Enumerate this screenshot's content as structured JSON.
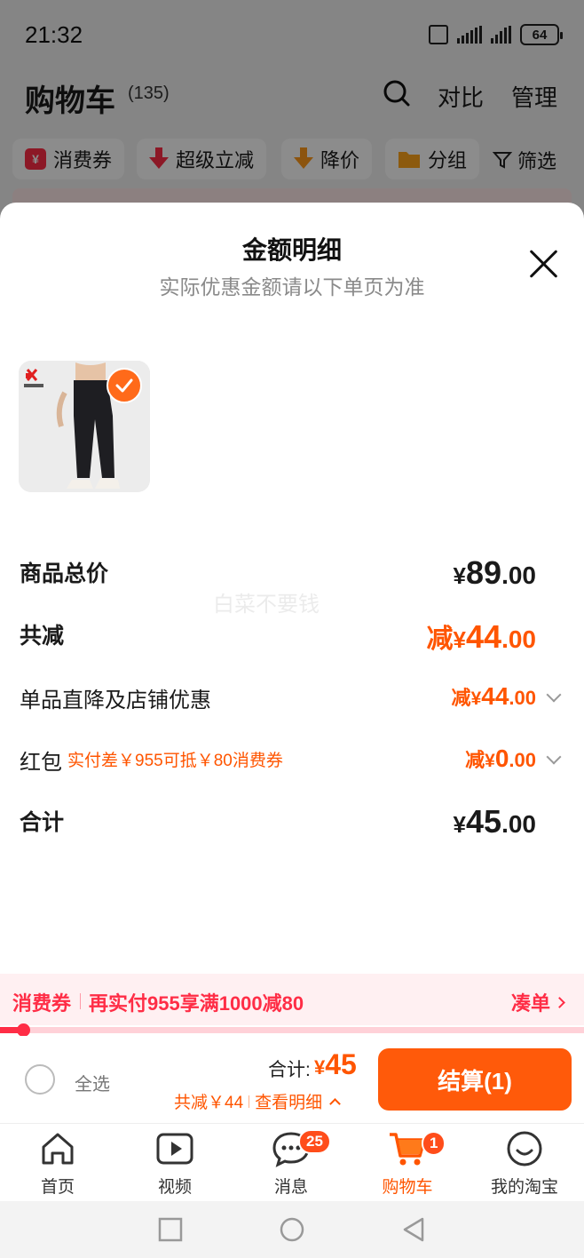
{
  "status_bar": {
    "time": "21:32",
    "battery": "64"
  },
  "background_page": {
    "title": "购物车",
    "count": "(135)",
    "actions": {
      "compare": "对比",
      "manage": "管理"
    },
    "filters": [
      {
        "label": "消费券",
        "icon": "coupon-icon",
        "icon_text": "¥",
        "color": "#ff2d46"
      },
      {
        "label": "超级立减",
        "icon": "down-arrow-icon",
        "color": "#ff2d46"
      },
      {
        "label": "降价",
        "icon": "price-drop-icon",
        "color": "#ff9a1a"
      },
      {
        "label": "分组",
        "icon": "folder-icon",
        "color": "#ffa41a"
      }
    ],
    "filter_plain": "筛选"
  },
  "sheet": {
    "title": "金额明细",
    "subtitle": "实际优惠金额请以下单页为准",
    "watermark": "白菜不要钱",
    "rows": {
      "goods_total": {
        "label": "商品总价",
        "currency": "¥",
        "int": "89",
        "dec": ".00"
      },
      "total_off": {
        "label": "共减",
        "prefix": "减",
        "currency": "¥",
        "int": "44",
        "dec": ".00"
      },
      "item_discount": {
        "label": "单品直降及店铺优惠",
        "prefix": "减",
        "currency": "¥",
        "int": "44",
        "dec": ".00"
      },
      "hongbao": {
        "label": "红包",
        "note": "实付差￥955可抵￥80消费券",
        "prefix": "减",
        "currency": "¥",
        "int": "0",
        "dec": ".00"
      },
      "sum": {
        "label": "合计",
        "currency": "¥",
        "int": "45",
        "dec": ".00"
      }
    },
    "coupon": {
      "tag": "消费券",
      "text": "再实付955享满1000减80",
      "cta": "凑单",
      "progress": 0.04
    }
  },
  "checkout": {
    "select_all": "全选",
    "total_label": "合计:",
    "total_currency": "¥",
    "total_value": "45",
    "saving": "共减￥44",
    "detail_link": "查看明细",
    "pay_button": "结算(1)"
  },
  "tabbar": [
    {
      "label": "首页",
      "icon": "home-icon"
    },
    {
      "label": "视频",
      "icon": "video-icon"
    },
    {
      "label": "消息",
      "icon": "message-icon",
      "badge": "25"
    },
    {
      "label": "购物车",
      "icon": "cart-icon",
      "badge": "1",
      "active": true
    },
    {
      "label": "我的淘宝",
      "icon": "profile-icon"
    }
  ],
  "colors": {
    "accent": "#ff5500",
    "coupon_red": "#ff2d46",
    "pay_button": "#ff5a0a"
  }
}
